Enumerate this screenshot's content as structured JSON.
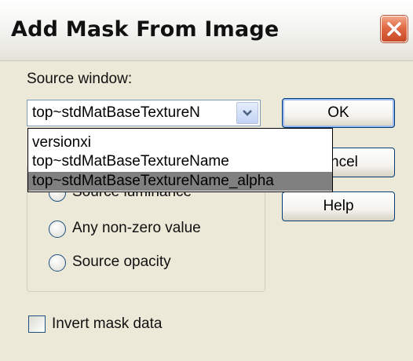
{
  "window": {
    "title": "Add Mask From Image"
  },
  "source": {
    "label": "Source window:",
    "selected_value": "top~stdMatBaseTextureN",
    "options": [
      "versionxi",
      "top~stdMatBaseTextureName",
      "top~stdMatBaseTextureName_alpha"
    ],
    "highlighted_index": 2
  },
  "buttons": {
    "ok": "OK",
    "cancel": "ncel",
    "help": "Help"
  },
  "mask_options": {
    "items": [
      "Source luminance",
      "Any non-zero value",
      "Source opacity"
    ]
  },
  "invert": {
    "label": "Invert mask data",
    "checked": false
  },
  "colors": {
    "dialog_bg": "#ece9d8",
    "close_red": "#e06a44",
    "highlight": "#808080"
  }
}
